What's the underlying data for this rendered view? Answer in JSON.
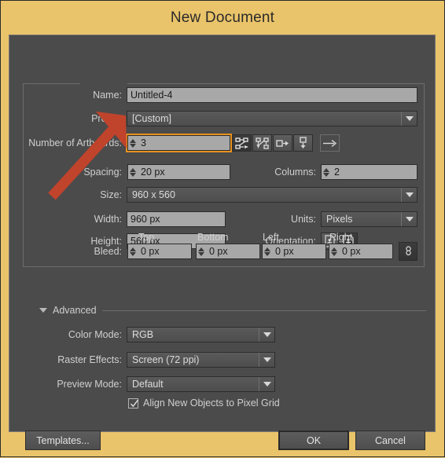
{
  "window": {
    "title": "New Document",
    "accent_orange": "#e8921f",
    "backdrop_color": "#eac46a",
    "panel_color": "#4b4b4b"
  },
  "fields": {
    "name": {
      "label": "Name:",
      "value": "Untitled-4"
    },
    "profile": {
      "label": "Profile:",
      "value": "[Custom]"
    },
    "artboards": {
      "label": "Number of Artboards:",
      "value": "3",
      "focused": true
    },
    "spacing": {
      "label": "Spacing:",
      "value": "20 px"
    },
    "columns": {
      "label": "Columns:",
      "value": "2"
    },
    "size": {
      "label": "Size:",
      "value": "960 x 560"
    },
    "width": {
      "label": "Width:",
      "value": "960 px"
    },
    "height": {
      "label": "Height:",
      "value": "560 px"
    },
    "units": {
      "label": "Units:",
      "value": "Pixels"
    },
    "orientation": {
      "label": "Orientation:"
    }
  },
  "artboard_layout_buttons": [
    {
      "name": "grid-by-row-icon",
      "active": true
    },
    {
      "name": "grid-by-column-icon",
      "active": false
    },
    {
      "name": "arrange-by-row-icon",
      "active": false
    },
    {
      "name": "arrange-by-column-icon",
      "active": false
    },
    {
      "name": "change-to-right-to-left-layout-icon",
      "active": false
    }
  ],
  "orientation_buttons": [
    {
      "name": "portrait-orientation-icon",
      "active": false
    },
    {
      "name": "landscape-orientation-icon",
      "active": true
    }
  ],
  "bleed": {
    "label": "Bleed:",
    "headers": [
      "Top",
      "Bottom",
      "Left",
      "Right"
    ],
    "values": [
      "0 px",
      "0 px",
      "0 px",
      "0 px"
    ],
    "link_icon": "chain-link-icon"
  },
  "advanced": {
    "label": "Advanced",
    "expanded": true,
    "color_mode": {
      "label": "Color Mode:",
      "value": "RGB"
    },
    "raster_effects": {
      "label": "Raster Effects:",
      "value": "Screen (72 ppi)"
    },
    "preview_mode": {
      "label": "Preview Mode:",
      "value": "Default"
    },
    "align_pixel_grid": {
      "label": "Align New Objects to Pixel Grid",
      "checked": true
    }
  },
  "footer": {
    "templates": "Templates...",
    "ok": "OK",
    "cancel": "Cancel"
  },
  "annotation": {
    "name": "red-arrow-pointer",
    "color": "#c0432c",
    "points_to": "artboards"
  }
}
